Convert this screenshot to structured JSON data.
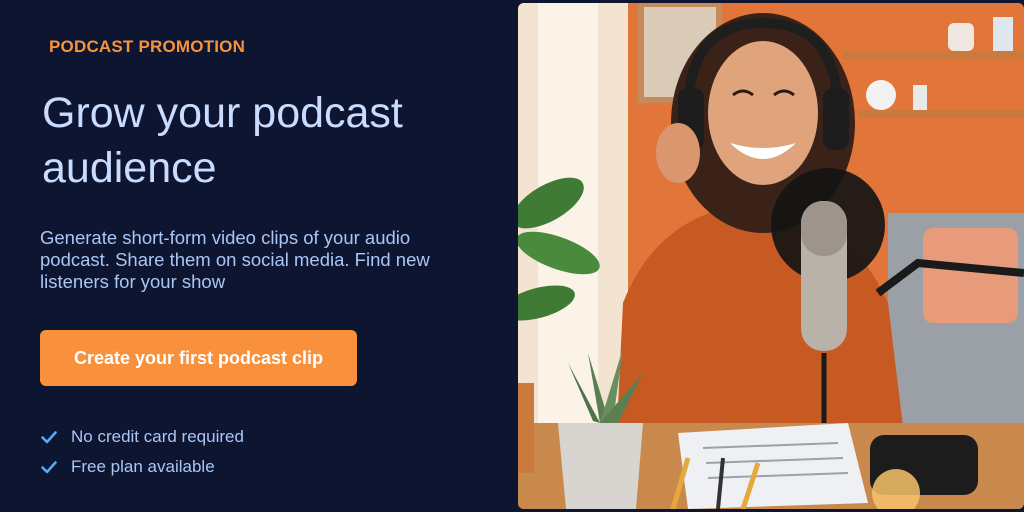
{
  "hero": {
    "eyebrow": "PODCAST PROMOTION",
    "headline": "Grow your podcast audience",
    "description": "Generate short-form video clips of your audio podcast. Share them on social media. Find new listeners for your show",
    "cta_label": "Create your first podcast clip",
    "benefits": [
      {
        "text": "No credit card required",
        "icon": "check-icon"
      },
      {
        "text": "Free plan available",
        "icon": "check-icon"
      }
    ]
  },
  "colors": {
    "background": "#0d1530",
    "accent": "#f9903c",
    "headline": "#c9dcff",
    "body_text": "#a9c6f6",
    "check": "#5aa7f5"
  }
}
